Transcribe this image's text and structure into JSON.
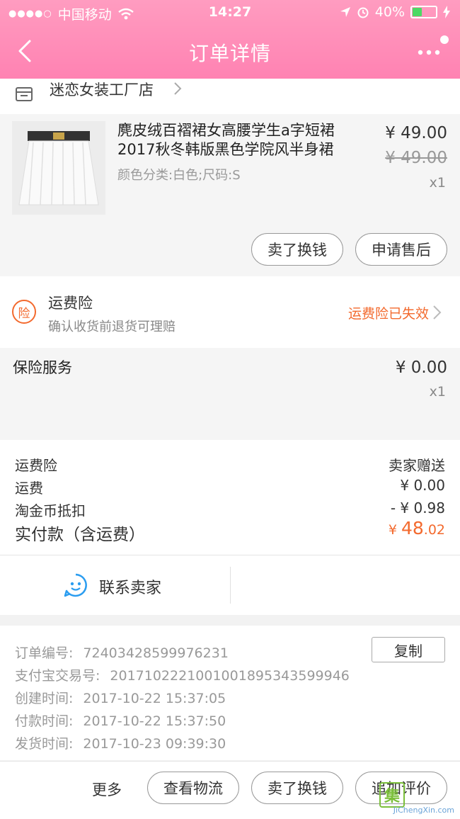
{
  "status_bar": {
    "carrier": "中国移动",
    "time": "14:27",
    "battery": "40%",
    "battery_level": 0.4,
    "icons": [
      "signal-dots",
      "wifi-icon",
      "location-arrow-icon",
      "alarm-icon",
      "battery-icon",
      "charging-bolt-icon"
    ]
  },
  "nav": {
    "title": "订单详情",
    "back_icon": "chevron-left-icon",
    "more_icon": "more-dots-icon"
  },
  "shop": {
    "name": "迷恋女装工厂店",
    "icon": "shop-icon"
  },
  "product": {
    "title": "麂皮绒百褶裙女高腰学生a字短裙2017秋冬韩版黑色学院风半身裙",
    "spec": "颜色分类:白色;尺码:S",
    "price": "¥ 49.00",
    "original_price": "¥ 49.00",
    "quantity": "x1",
    "actions": [
      "卖了换钱",
      "申请售后"
    ]
  },
  "freight_insurance": {
    "icon_text": "险",
    "title": "运费险",
    "subtitle": "确认收货前退货可理赔",
    "status": "运费险已失效"
  },
  "insurance_service": {
    "title": "保险服务",
    "price": "¥ 0.00",
    "quantity": "x1"
  },
  "cost": {
    "rows": [
      {
        "label": "运费险",
        "value": "卖家赠送"
      },
      {
        "label": "运费",
        "value": "¥ 0.00"
      },
      {
        "label": "淘金币抵扣",
        "value": "- ¥ 0.98"
      }
    ],
    "total_label": "实付款（含运费）",
    "total_currency": "¥ ",
    "total_int": "48",
    "total_dec": ".02"
  },
  "contact": {
    "label": "联系卖家"
  },
  "order_info": {
    "copy_label": "复制",
    "lines": [
      {
        "label": "订单编号:",
        "value": "72403428599976231"
      },
      {
        "label": "支付宝交易号:",
        "value": "2017102221001001895343599946"
      },
      {
        "label": "创建时间:",
        "value": "2017-10-22 15:37:05"
      },
      {
        "label": "付款时间:",
        "value": "2017-10-22 15:37:50"
      },
      {
        "label": "发货时间:",
        "value": "2017-10-23 09:39:30"
      }
    ]
  },
  "bottom_bar": {
    "more": "更多",
    "buttons": [
      "查看物流",
      "卖了换钱",
      "追加评价"
    ]
  },
  "watermark": {
    "logo": "集",
    "text": "JiChengXin.com"
  },
  "colors": {
    "header": "#ff8fb8",
    "accent": "#f36a2e",
    "contact_icon": "#2b9df0",
    "charging": "#4cd964"
  }
}
